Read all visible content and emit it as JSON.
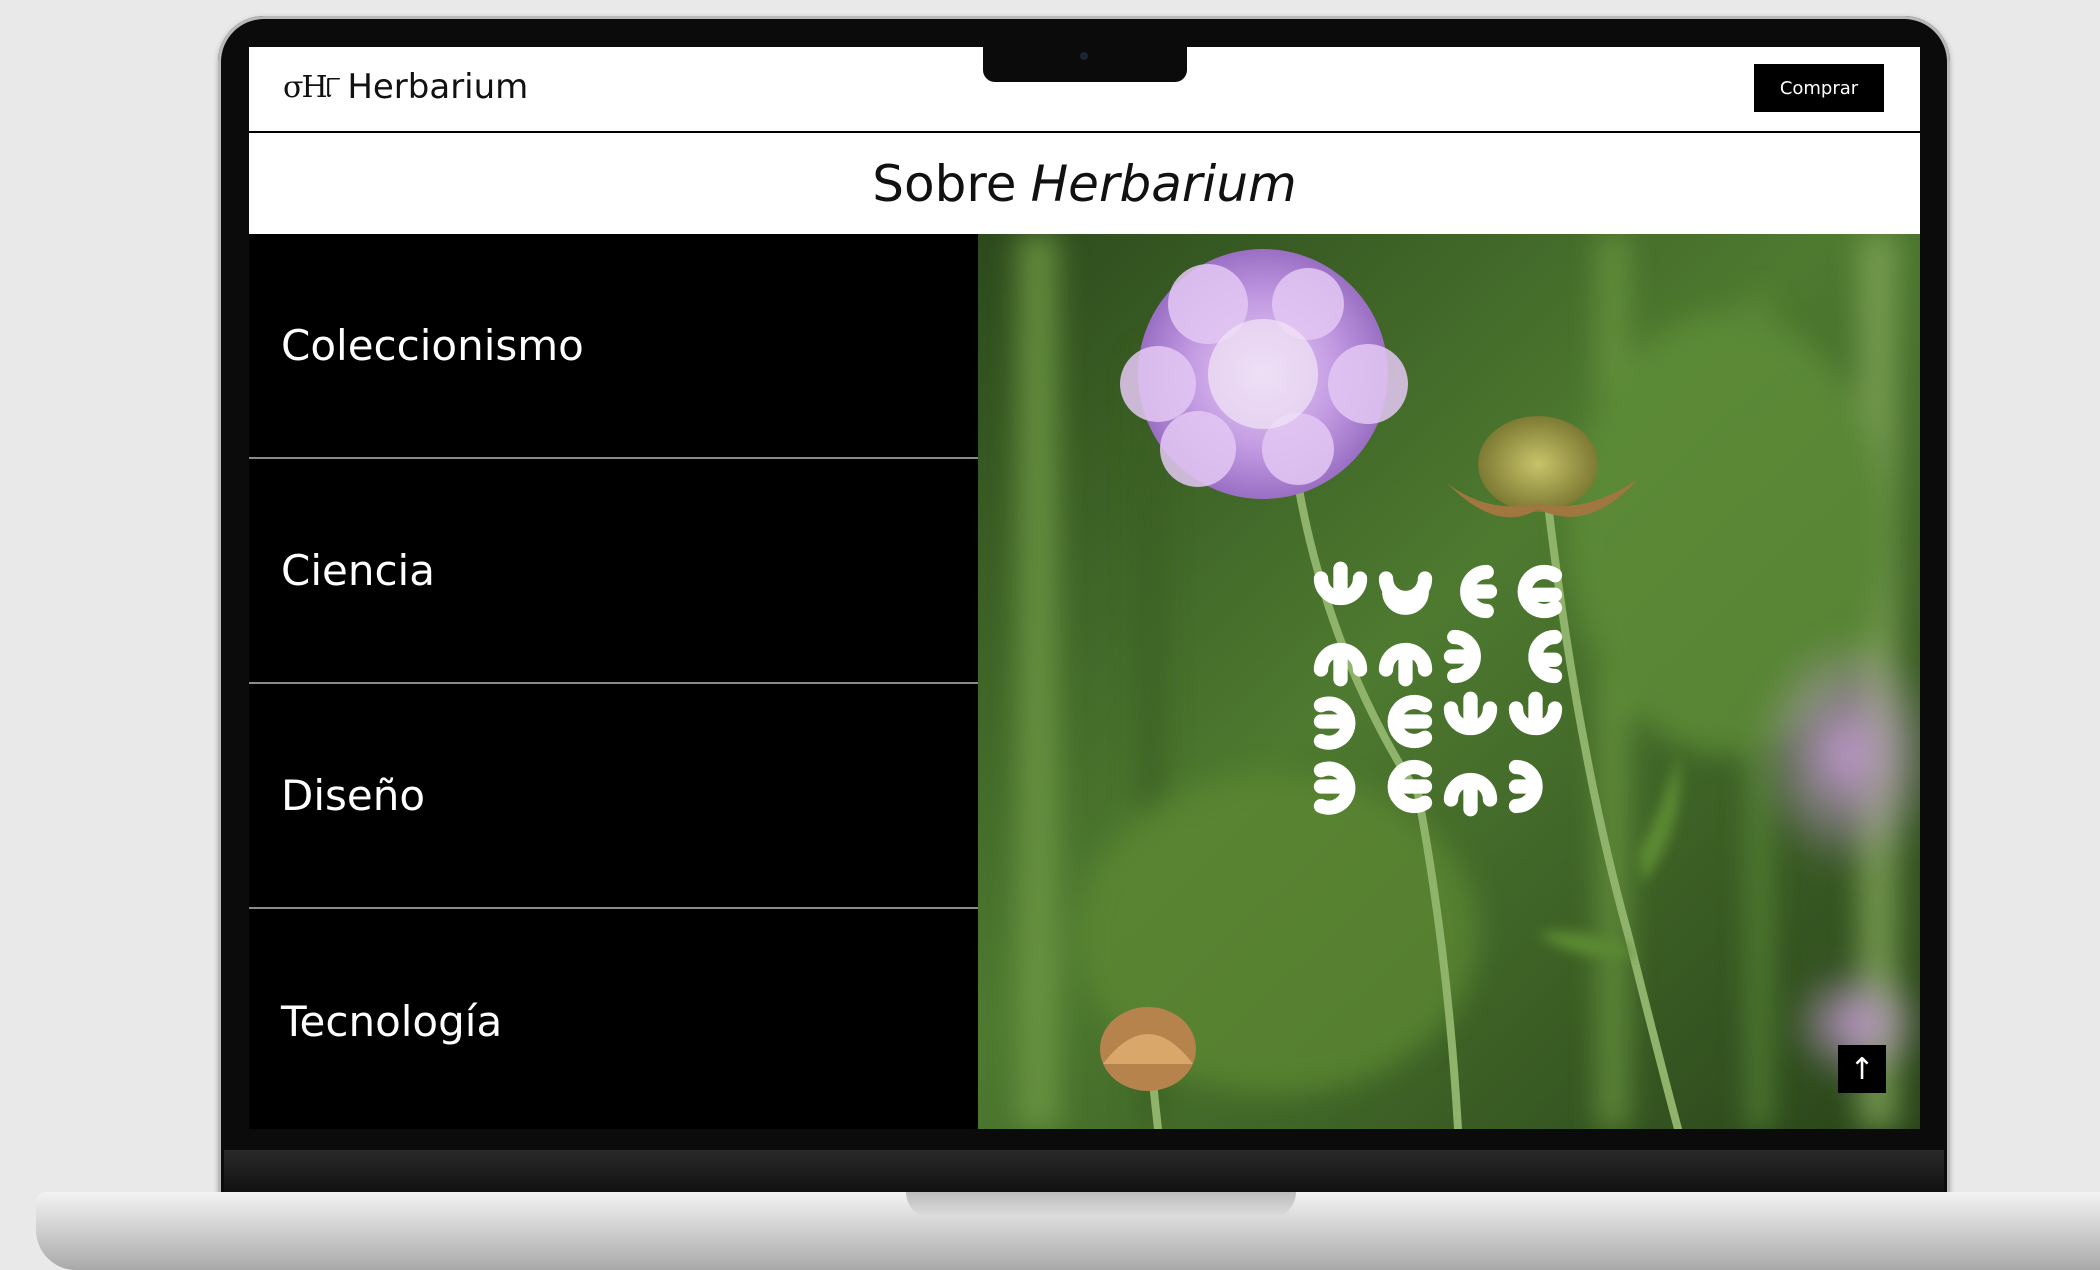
{
  "nav": {
    "logo_mark": "σH୮",
    "brand": "Herbarium",
    "buy_label": "Comprar"
  },
  "page_title": {
    "prefix": "Sobre",
    "emphasis": "Herbarium"
  },
  "menu": {
    "items": [
      {
        "label": "Coleccionismo"
      },
      {
        "label": "Ciencia"
      },
      {
        "label": "Diseño"
      },
      {
        "label": "Tecnología"
      }
    ]
  },
  "hero": {
    "scroll_top_icon": "↑"
  },
  "colors": {
    "background": "#e9e9e9",
    "menu_bg": "#000000",
    "divider": "#8a8a8a",
    "flower": "#c9a2e6",
    "foliage": "#3f6b2a"
  }
}
